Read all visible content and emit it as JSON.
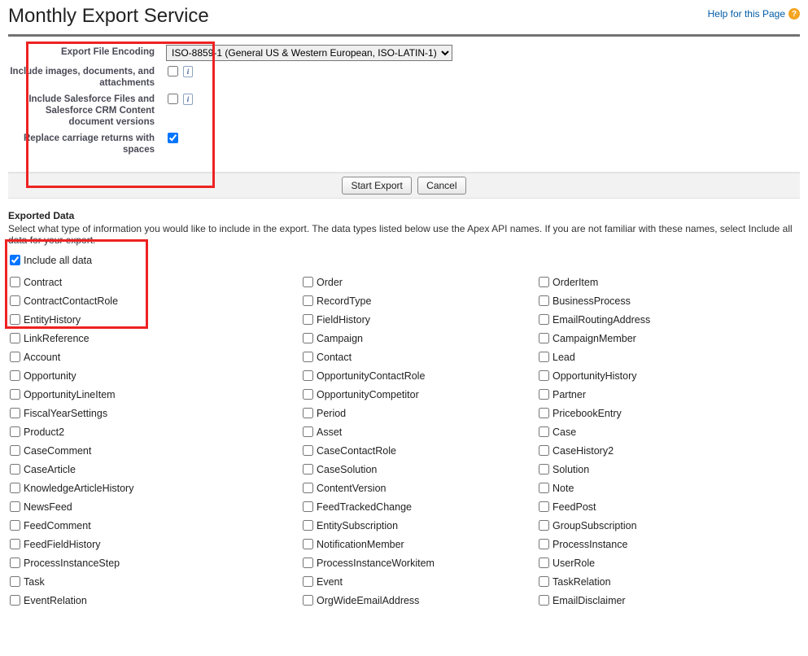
{
  "header": {
    "title": "Monthly Export Service",
    "help_label": "Help for this Page"
  },
  "settings": {
    "encoding_label": "Export File Encoding",
    "encoding_value": "ISO-8859-1 (General US & Western European, ISO-LATIN-1)",
    "include_images_label": "Include images, documents, and attachments",
    "include_images_checked": false,
    "include_files_label": "Include Salesforce Files and Salesforce CRM Content document versions",
    "include_files_checked": false,
    "replace_cr_label": "Replace carriage returns with spaces",
    "replace_cr_checked": true
  },
  "buttons": {
    "start_export": "Start Export",
    "cancel": "Cancel"
  },
  "exported": {
    "heading": "Exported Data",
    "description": "Select what type of information you would like to include in the export. The data types listed below use the Apex API names. If you are not familiar with these names, select Include all data for your export.",
    "include_all_label": "Include all data",
    "include_all_checked": true
  },
  "items_col1": [
    "Contract",
    "ContractContactRole",
    "EntityHistory",
    "LinkReference",
    "Account",
    "Opportunity",
    "OpportunityLineItem",
    "FiscalYearSettings",
    "Product2",
    "CaseComment",
    "CaseArticle",
    "KnowledgeArticleHistory",
    "NewsFeed",
    "FeedComment",
    "FeedFieldHistory",
    "ProcessInstanceStep",
    "Task",
    "EventRelation"
  ],
  "items_col2": [
    "Order",
    "RecordType",
    "FieldHistory",
    "Campaign",
    "Contact",
    "OpportunityContactRole",
    "OpportunityCompetitor",
    "Period",
    "Asset",
    "CaseContactRole",
    "CaseSolution",
    "ContentVersion",
    "FeedTrackedChange",
    "EntitySubscription",
    "NotificationMember",
    "ProcessInstanceWorkitem",
    "Event",
    "OrgWideEmailAddress"
  ],
  "items_col3": [
    "OrderItem",
    "BusinessProcess",
    "EmailRoutingAddress",
    "CampaignMember",
    "Lead",
    "OpportunityHistory",
    "Partner",
    "PricebookEntry",
    "Case",
    "CaseHistory2",
    "Solution",
    "Note",
    "FeedPost",
    "GroupSubscription",
    "ProcessInstance",
    "UserRole",
    "TaskRelation",
    "EmailDisclaimer"
  ]
}
